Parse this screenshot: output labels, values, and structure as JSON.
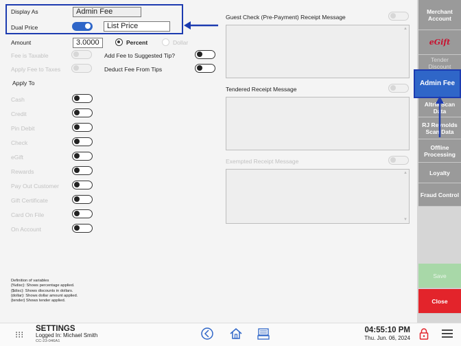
{
  "form": {
    "display_as_label": "Display As",
    "display_as_value": "Admin Fee",
    "dual_price_label": "Dual Price",
    "dual_price_value": "List Price",
    "amount_label": "Amount",
    "amount_value": "3.0000",
    "percent_label": "Percent",
    "dollar_label": "Dollar",
    "fee_taxable_label": "Fee is Taxable",
    "apply_fee_taxes_label": "Apply Fee to Taxes",
    "add_fee_tip_label": "Add Fee to Suggested Tip?",
    "deduct_fee_tips_label": "Deduct Fee From Tips",
    "apply_to_label": "Apply To",
    "apply_to_items": [
      "Cash",
      "Credit",
      "Pin Debit",
      "Check",
      "eGift",
      "Rewards",
      "Pay Out Customer",
      "Gift Certificate",
      "Card On File",
      "On Account"
    ]
  },
  "messages": {
    "guest_check_label": "Guest Check (Pre-Payment) Receipt Message",
    "tendered_label": "Tendered Receipt Message",
    "exempted_label": "Exempted Receipt Message"
  },
  "definitions": {
    "title": "Definition of variables",
    "lines": [
      "{%disc}: Shows percentage applied.",
      "{$disc}: Shows discounts in dollars.",
      "{dollar}: Shows dollar amount applied.",
      "{tender} Shows tender applied."
    ]
  },
  "nav": {
    "merchant_account": "Merchant Account",
    "egift_logo": "eGift",
    "tender_discount": "Tender Discount",
    "admin_fee": "Admin Fee",
    "altria_scan": "Altria Scan Data",
    "rj_reynolds": "RJ Reynolds Scan Data",
    "offline_processing": "Offline Processing",
    "loyalty": "Loyalty",
    "fraud_control": "Fraud Control",
    "save": "Save",
    "close": "Close"
  },
  "footer": {
    "title": "SETTINGS",
    "logged_in": "Logged In:  Michael Smith",
    "device_id": "CC-23-046A1",
    "time": "04:55:10 PM",
    "date": "Thu. Jun. 06, 2024"
  },
  "colors": {
    "accent": "#2f66c8",
    "annotation": "#1c3bb0",
    "save_green": "#a8d8a8",
    "close_red": "#e3242b",
    "egift_red": "#c8102e"
  }
}
